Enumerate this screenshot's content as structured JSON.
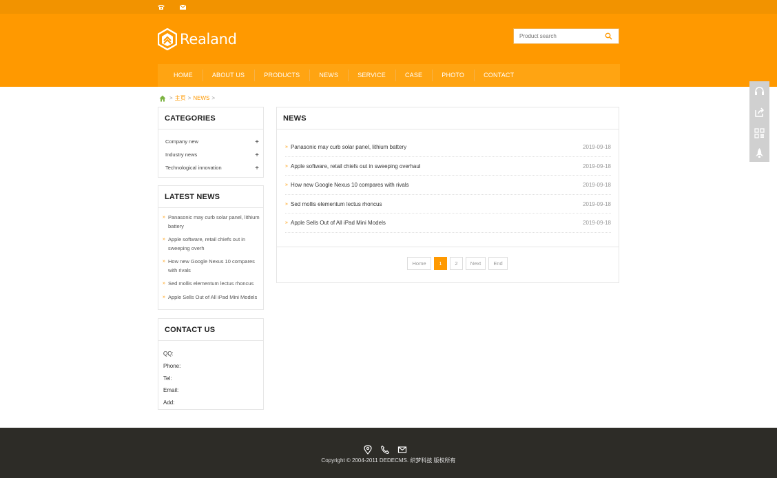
{
  "topbar": {
    "phone_icon": "phone-icon",
    "mail_icon": "mail-icon"
  },
  "logo": {
    "text": "Realand"
  },
  "search": {
    "placeholder": "Product search"
  },
  "nav": [
    "HOME",
    "ABOUT US",
    "PRODUCTS",
    "NEWS",
    "SERVICE",
    "CASE",
    "PHOTO",
    "CONTACT"
  ],
  "breadcrumb": {
    "home": "主页",
    "current": "NEWS",
    "sep": ">"
  },
  "categories": {
    "title": "CATEGORIES",
    "items": [
      "Company new",
      "Industry news",
      "Technological innovation"
    ],
    "plus": "+"
  },
  "latest_news": {
    "title": "LATEST NEWS",
    "items": [
      "Panasonic may curb solar panel, lithium battery",
      "Apple software, retail chiefs out in sweeping overh",
      "How new Google Nexus 10 compares with rivals",
      "Sed mollis elementum lectus rhoncus",
      "Apple Sells Out of All iPad Mini Models"
    ]
  },
  "contact": {
    "title": "CONTACT US",
    "items": [
      "QQ:",
      "Phone:",
      "Tel:",
      "Email:",
      "Add:"
    ]
  },
  "news": {
    "title": "NEWS",
    "rows": [
      {
        "title": "Panasonic may curb solar panel, lithium battery",
        "date": "2019-09-18"
      },
      {
        "title": "Apple software, retail chiefs out in sweeping overhaul",
        "date": "2019-09-18"
      },
      {
        "title": "How new Google Nexus 10 compares with rivals",
        "date": "2019-09-18"
      },
      {
        "title": "Sed mollis elementum lectus rhoncus",
        "date": "2019-09-18"
      },
      {
        "title": "Apple Sells Out of All iPad Mini Models",
        "date": "2019-09-18"
      }
    ],
    "pager": [
      "Home",
      "1",
      "2",
      "Next",
      "End"
    ]
  },
  "footer": {
    "copyright": "Copyright © 2004-2011 DEDECMS. 织梦科技 版权所有"
  },
  "colors": {
    "brand": "#ff9900",
    "footer_bg": "#2d2c27"
  }
}
